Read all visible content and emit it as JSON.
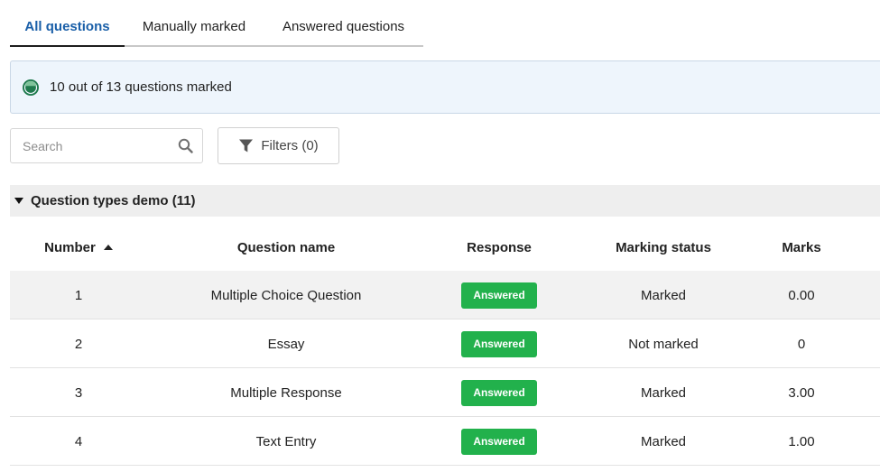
{
  "tabs": [
    {
      "label": "All questions",
      "active": true
    },
    {
      "label": "Manually marked",
      "active": false
    },
    {
      "label": "Answered questions",
      "active": false
    }
  ],
  "banner": {
    "text": "10 out of 13 questions marked",
    "progress": 0.77,
    "icon": "progress-circle-icon"
  },
  "search": {
    "placeholder": "Search",
    "value": ""
  },
  "filters": {
    "label": "Filters (0)"
  },
  "group": {
    "title": "Question types demo (11)",
    "expanded": true
  },
  "table": {
    "columns": [
      "Number",
      "Question name",
      "Response",
      "Marking status",
      "Marks"
    ],
    "sort": {
      "column": "Number",
      "direction": "ascending"
    },
    "rows": [
      {
        "number": "1",
        "name": "Multiple Choice Question",
        "response": "Answered",
        "status": "Marked",
        "marks": "0.00"
      },
      {
        "number": "2",
        "name": "Essay",
        "response": "Answered",
        "status": "Not marked",
        "marks": "0"
      },
      {
        "number": "3",
        "name": "Multiple Response",
        "response": "Answered",
        "status": "Marked",
        "marks": "3.00"
      },
      {
        "number": "4",
        "name": "Text Entry",
        "response": "Answered",
        "status": "Marked",
        "marks": "1.00"
      }
    ]
  },
  "colors": {
    "active_tab": "#1a5fa8",
    "badge": "#22b14c",
    "banner_bg": "#eef5fc",
    "progress_icon": "#1f7a4d"
  }
}
